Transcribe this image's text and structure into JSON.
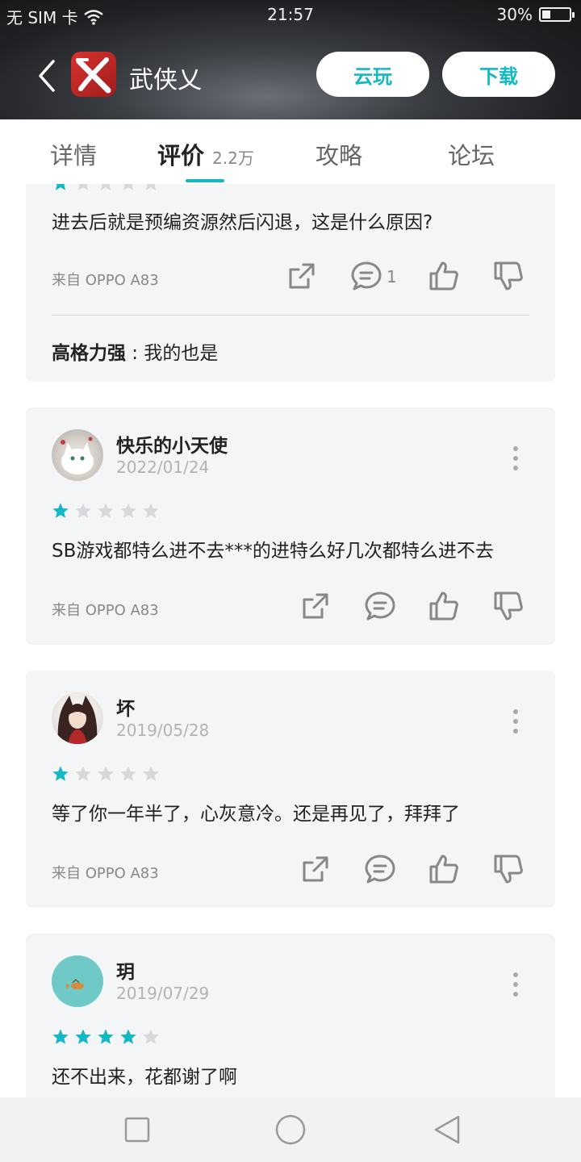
{
  "status_bar": {
    "carrier": "无 SIM 卡",
    "time": "21:57",
    "battery_text": "30%",
    "battery_level": 0.3
  },
  "header": {
    "app_name": "武侠乂",
    "cloud_play": "云玩",
    "download": "下载"
  },
  "tabs": [
    {
      "label": "详情"
    },
    {
      "label": "评价",
      "count": "2.2万"
    },
    {
      "label": "攻略"
    },
    {
      "label": "论坛"
    }
  ],
  "reviews": [
    {
      "text": "进去后就是预编资源然后闪退，这是什么原因?",
      "device": "来自 OPPO A83",
      "comment_count": "1",
      "reply": {
        "user": "高格力强",
        "sep": " : ",
        "text": "我的也是"
      }
    },
    {
      "user": "快乐的小天使",
      "date": "2022/01/24",
      "stars": 1,
      "text": "SB游戏都特么进不去***的进特么好几次都特么进不去",
      "device": "来自 OPPO A83"
    },
    {
      "user": "坏",
      "date": "2019/05/28",
      "stars": 1,
      "text": "等了你一年半了，心灰意冷。还是再见了，拜拜了",
      "device": "来自 OPPO A83"
    },
    {
      "user": "玥",
      "date": "2019/07/29",
      "stars": 4,
      "text": "还不出来，花都谢了啊"
    }
  ],
  "colors": {
    "accent": "#14b8c4",
    "star_off": "#d6d8db",
    "card_bg": "#f4f5f7"
  }
}
